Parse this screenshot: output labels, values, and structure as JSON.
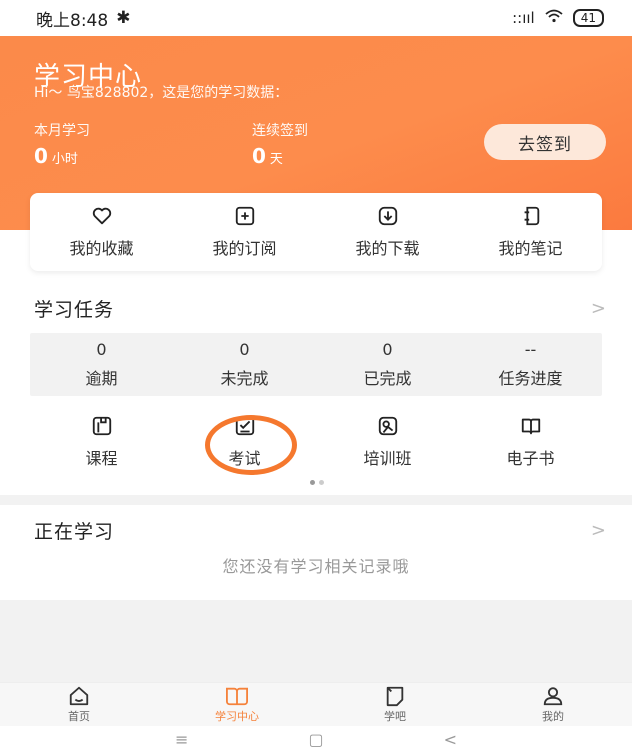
{
  "status_bar": {
    "time": "晚上8:48",
    "bluetooth": "✱",
    "signal": "::ııl",
    "wifi": "•",
    "battery": "41"
  },
  "hero": {
    "title": "学习中心",
    "subtitle": "Hi～ 鸟宝828802，这是您的学习数据：",
    "month_label": "本月学习",
    "month_value": "0",
    "month_unit": "小时",
    "streak_label": "连续签到",
    "streak_value": "0",
    "streak_unit": "天",
    "checkin": "去签到",
    "colors": {
      "start": "#fb8a4a",
      "end": "#fb7a3f"
    }
  },
  "quick": [
    {
      "label": "我的收藏",
      "icon": "heart-icon"
    },
    {
      "label": "我的订阅",
      "icon": "subscribe-icon"
    },
    {
      "label": "我的下载",
      "icon": "download-icon"
    },
    {
      "label": "我的笔记",
      "icon": "note-icon"
    }
  ],
  "tasks": {
    "title": "学习任务",
    "chevron": ">",
    "items": [
      {
        "num": "0",
        "label": "逾期"
      },
      {
        "num": "0",
        "label": "未完成"
      },
      {
        "num": "0",
        "label": "已完成"
      },
      {
        "num": "--",
        "label": "任务进度"
      }
    ]
  },
  "functions": [
    {
      "label": "课程",
      "icon": "course-icon"
    },
    {
      "label": "考试",
      "icon": "exam-icon"
    },
    {
      "label": "培训班",
      "icon": "training-icon"
    },
    {
      "label": "电子书",
      "icon": "ebook-icon"
    }
  ],
  "learning": {
    "title": "正在学习",
    "chevron": ">",
    "empty": "您还没有学习相关记录哦"
  },
  "tabs": [
    {
      "label": "首页",
      "icon": "home-icon",
      "active": false
    },
    {
      "label": "学习中心",
      "icon": "learning-center-icon",
      "active": true
    },
    {
      "label": "学吧",
      "icon": "study-bar-icon",
      "active": false
    },
    {
      "label": "我的",
      "icon": "profile-icon",
      "active": false
    }
  ],
  "sysnav": {
    "menu": "≡",
    "home": "▢",
    "back": "<"
  },
  "accent_color": "#f5823b"
}
